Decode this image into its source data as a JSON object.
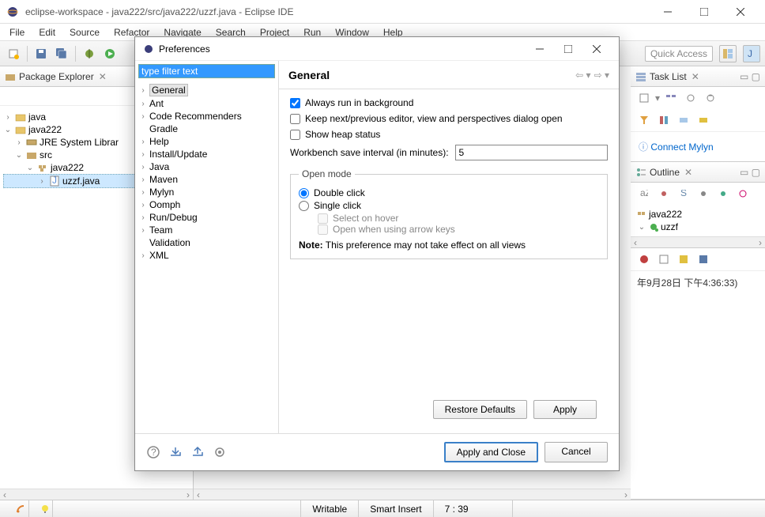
{
  "window": {
    "title": "eclipse-workspace - java222/src/java222/uzzf.java - Eclipse IDE"
  },
  "menubar": [
    "File",
    "Edit",
    "Source",
    "Refactor",
    "Navigate",
    "Search",
    "Project",
    "Run",
    "Window",
    "Help"
  ],
  "quick_access_placeholder": "Quick Access",
  "package_explorer": {
    "title": "Package Explorer",
    "items": [
      {
        "label": "java",
        "icon": "project",
        "exp": "closed",
        "depth": 0
      },
      {
        "label": "java222",
        "icon": "project",
        "exp": "open",
        "depth": 0
      },
      {
        "label": "JRE System Librar",
        "icon": "library",
        "exp": "closed",
        "depth": 1
      },
      {
        "label": "src",
        "icon": "src",
        "exp": "open",
        "depth": 1
      },
      {
        "label": "java222",
        "icon": "package",
        "exp": "open",
        "depth": 2
      },
      {
        "label": "uzzf.java",
        "icon": "jfile",
        "exp": "none",
        "depth": 3,
        "selected": true
      }
    ]
  },
  "preferences": {
    "dialog_title": "Preferences",
    "filter_placeholder": "type filter text",
    "tree": [
      "General",
      "Ant",
      "Code Recommenders",
      "Gradle",
      "Help",
      "Install/Update",
      "Java",
      "Maven",
      "Mylyn",
      "Oomph",
      "Run/Debug",
      "Team",
      "Validation",
      "XML"
    ],
    "tree_no_arrow": [
      "Gradle",
      "Validation"
    ],
    "selected_node": "General",
    "header_title": "General",
    "chk_always_run": "Always run in background",
    "chk_always_run_checked": true,
    "chk_keep_next": "Keep next/previous editor, view and perspectives dialog open",
    "chk_keep_next_checked": false,
    "chk_heap": "Show heap status",
    "chk_heap_checked": false,
    "save_interval_label": "Workbench save interval (in minutes):",
    "save_interval_value": "5",
    "open_mode_legend": "Open mode",
    "radio_double": "Double click",
    "radio_single": "Single click",
    "radio_selected": "double",
    "sub_select_hover": "Select on hover",
    "sub_open_arrow": "Open when using arrow keys",
    "note_label": "Note:",
    "note_text": "This preference may not take effect on all views",
    "btn_restore": "Restore Defaults",
    "btn_apply": "Apply",
    "btn_apply_close": "Apply and Close",
    "btn_cancel": "Cancel"
  },
  "task_list": {
    "title": "Task List"
  },
  "connect_mylyn": "Connect Mylyn",
  "outline": {
    "title": "Outline",
    "items": [
      "java222",
      "uzzf"
    ]
  },
  "bottom_timestamp": "年9月28日 下午4:36:33)",
  "statusbar": {
    "writable": "Writable",
    "insert": "Smart Insert",
    "pos": "7 : 39"
  }
}
